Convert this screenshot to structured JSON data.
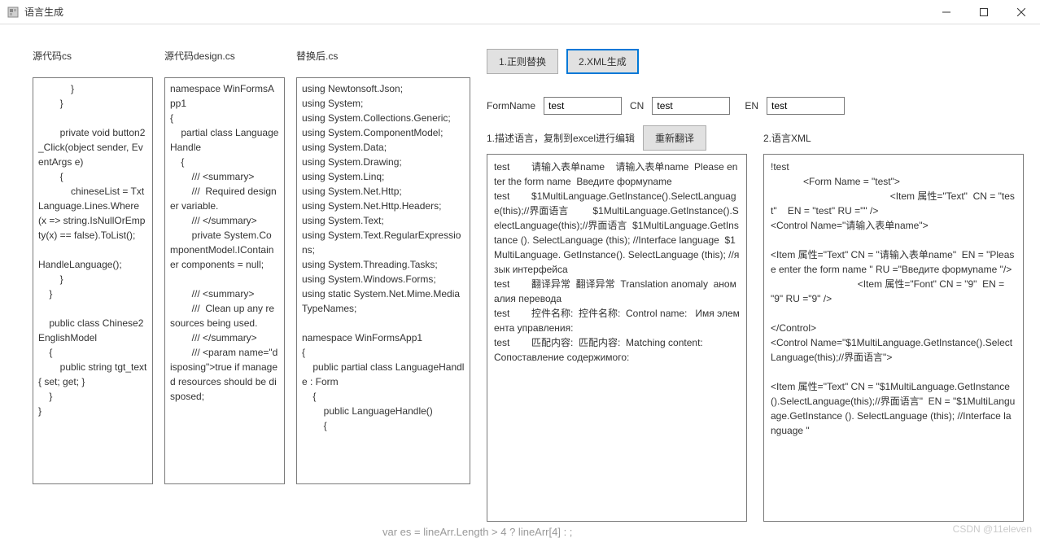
{
  "window": {
    "title": "语言生成"
  },
  "columns": {
    "source_cs": {
      "label": "源代码cs",
      "content": "            }\n        }\n\n        private void button2_Click(object sender, EventArgs e)\n        {\n            chineseList = TxtLanguage.Lines.Where(x => string.IsNullOrEmpty(x) == false).ToList();\n\nHandleLanguage();\n        }\n    }\n\n    public class Chinese2EnglishModel\n    {\n        public string tgt_text { set; get; }\n    }\n}"
    },
    "design_cs": {
      "label": "源代码design.cs",
      "content": "namespace WinFormsApp1\n{\n    partial class LanguageHandle\n    {\n        /// <summary>\n        ///  Required designer variable.\n        /// </summary>\n        private System.ComponentModel.IContainer components = null;\n\n        /// <summary>\n        ///  Clean up any resources being used.\n        /// </summary>\n        /// <param name=\"disposing\">true if managed resources should be disposed;"
    },
    "replaced_cs": {
      "label": "替换后.cs",
      "content": "using Newtonsoft.Json;\nusing System;\nusing System.Collections.Generic;\nusing System.ComponentModel;\nusing System.Data;\nusing System.Drawing;\nusing System.Linq;\nusing System.Net.Http;\nusing System.Net.Http.Headers;\nusing System.Text;\nusing System.Text.RegularExpressions;\nusing System.Threading.Tasks;\nusing System.Windows.Forms;\nusing static System.Net.Mime.MediaTypeNames;\n\nnamespace WinFormsApp1\n{\n    public partial class LanguageHandle : Form\n    {\n        public LanguageHandle()\n        {"
    }
  },
  "buttons": {
    "regex_replace": "1.正则替换",
    "xml_gen": "2.XML生成",
    "retranslate": "重新翻译"
  },
  "form_row": {
    "form_name_label": "FormName",
    "form_name_value": "test",
    "cn_label": "CN",
    "cn_value": "test",
    "en_label": "EN",
    "en_value": "test"
  },
  "lower": {
    "desc_label": "1.描述语言，复制到excel进行编辑",
    "xml_label": "2.语言XML",
    "desc_content": "test        请输入表单name    请输入表单name  Please enter the form name  Введите формуname\ntest        $1MultiLanguage.GetInstance().SelectLanguage(this);//界面语言         $1MultiLanguage.GetInstance().SelectLanguage(this);//界面语言  $1MultiLanguage.GetInstance (). SelectLanguage (this); //Interface language  $1MultiLanguage. GetInstance(). SelectLanguage (this); //язык интерфейса\ntest        翻译异常  翻译异常  Translation anomaly  аномалия перевода\ntest        控件名称:  控件名称:  Control name:   Имя элемента управления:\ntest        匹配内容:  匹配内容:  Matching content:           Сопоставление содержимого:",
    "xml_content": "!test\n            <Form Name = \"test\">\n                                            <Item 属性=\"Text\"  CN = \"test\"    EN = \"test\" RU =\"\" />\n<Control Name=\"请输入表单name\">\n\n<Item 属性=\"Text\" CN = \"请输入表单name\"  EN = \"Please enter the form name \" RU =\"Введите формуname \"/>\n                                <Item 属性=\"Font\" CN = \"9\"  EN = \"9\" RU =\"9\" />\n\n</Control>\n<Control Name=\"$1MultiLanguage.GetInstance().SelectLanguage(this);//界面语言\">\n\n<Item 属性=\"Text\" CN = \"$1MultiLanguage.GetInstance().SelectLanguage(this);//界面语言\"  EN = \"$1MultiLanguage.GetInstance (). SelectLanguage (this); //Interface language \""
  },
  "bottom_text": "var es = lineArr.Length > 4 ? lineArr[4] : ;",
  "watermark": "CSDN @11eleven"
}
